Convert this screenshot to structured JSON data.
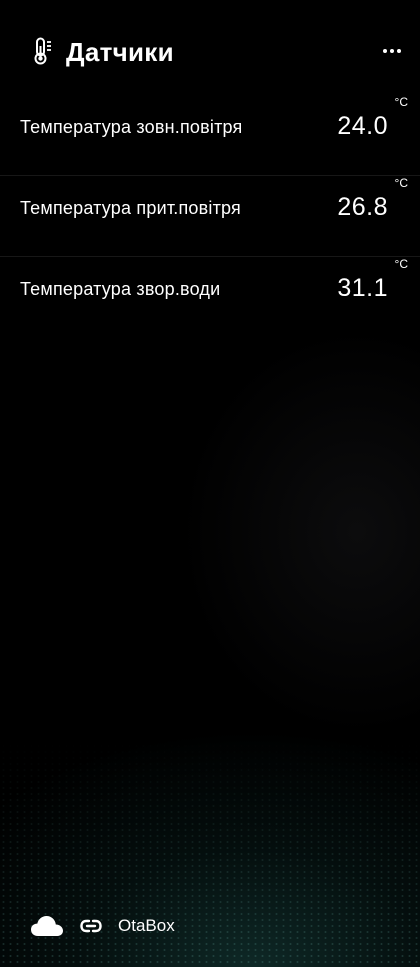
{
  "header": {
    "title": "Датчики",
    "icon": "thermometer-icon",
    "menu_icon": "more-dots-icon"
  },
  "sensors": [
    {
      "label": "Температура зовн.повітря",
      "value": "24.0",
      "unit": "°C"
    },
    {
      "label": "Температура прит.повітря",
      "value": "26.8",
      "unit": "°C"
    },
    {
      "label": "Температура звор.води",
      "value": "31.1",
      "unit": "°C"
    }
  ],
  "footer": {
    "cloud_icon": "cloud-icon",
    "link_icon": "link-icon",
    "device_name": "OtaBox"
  },
  "colors": {
    "background": "#000000",
    "text": "#ffffff",
    "accent_glow": "#1a4a46"
  }
}
